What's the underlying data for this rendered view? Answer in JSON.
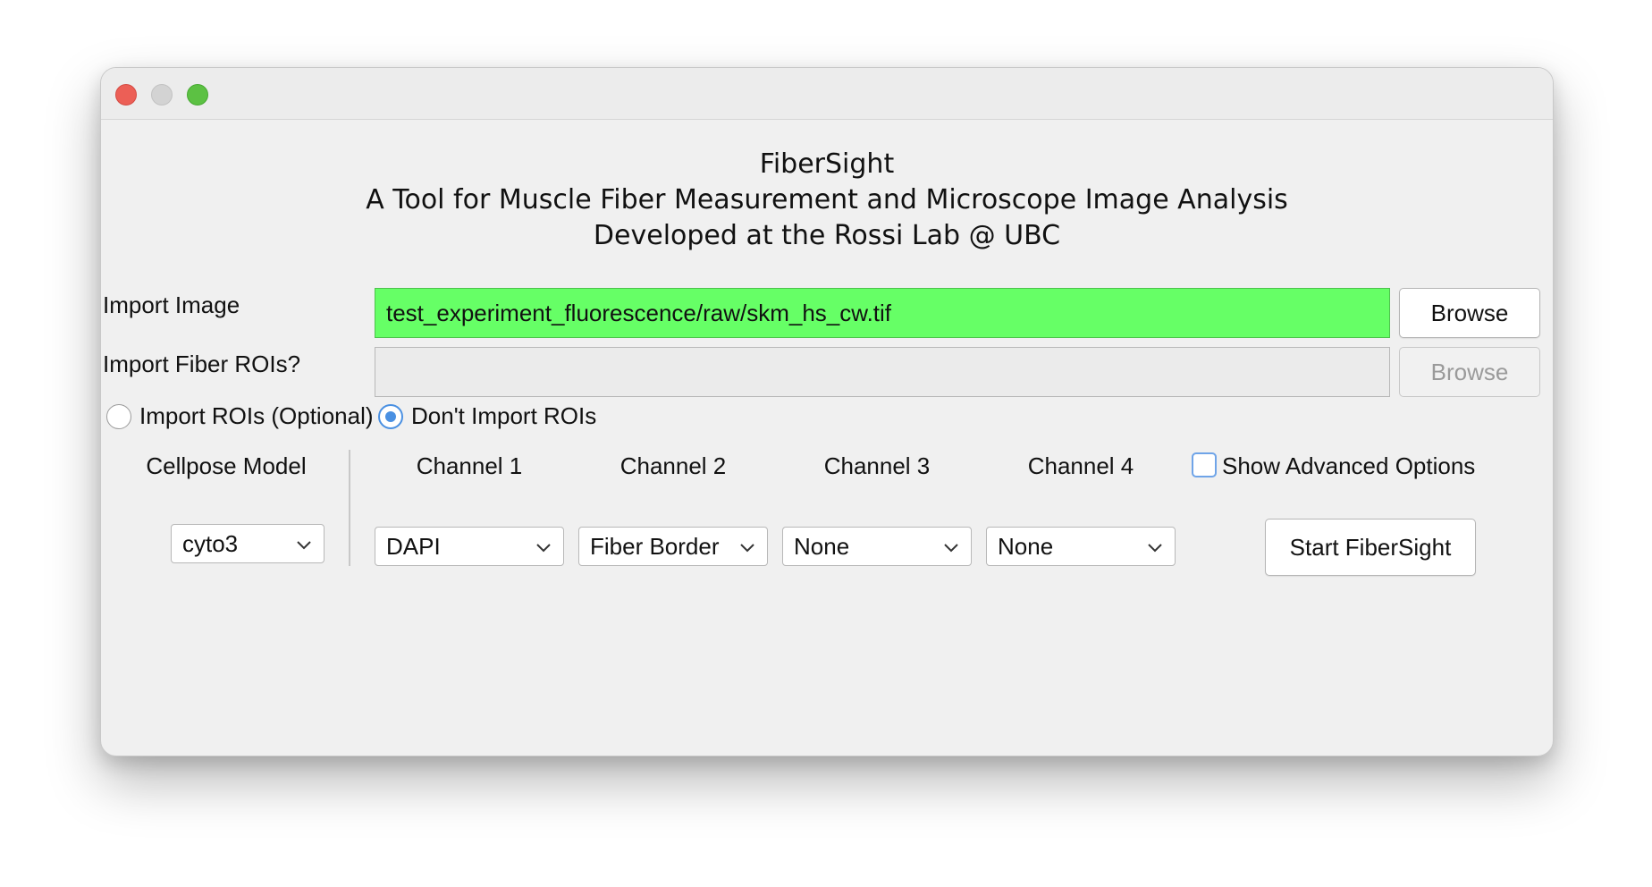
{
  "window": {
    "title_lines": [
      "FiberSight",
      "A Tool for Muscle Fiber Measurement and Microscope Image Analysis",
      "Developed at the Rossi Lab @ UBC"
    ]
  },
  "import_image": {
    "label": "Import Image",
    "value": "test_experiment_fluorescence/raw/skm_hs_cw.tif",
    "browse_label": "Browse",
    "field_color": "#66ff66"
  },
  "import_rois": {
    "label": "Import Fiber ROIs?",
    "value": "",
    "browse_label": "Browse"
  },
  "roi_options": {
    "import_label": "Import ROIs (Optional)",
    "dont_import_label": "Don't Import ROIs",
    "selected": "Don't Import ROIs"
  },
  "model": {
    "heading": "Cellpose Model",
    "selected": "cyto3"
  },
  "channels": {
    "ch1_heading": "Channel 1",
    "ch2_heading": "Channel 2",
    "ch3_heading": "Channel 3",
    "ch4_heading": "Channel 4",
    "ch1_value": "DAPI",
    "ch2_value": "Fiber Border",
    "ch3_value": "None",
    "ch4_value": "None"
  },
  "advanced": {
    "label": "Show Advanced Options",
    "checked": false
  },
  "start_label": "Start FiberSight",
  "icons": {
    "dropdown": "chevron-down-icon"
  }
}
